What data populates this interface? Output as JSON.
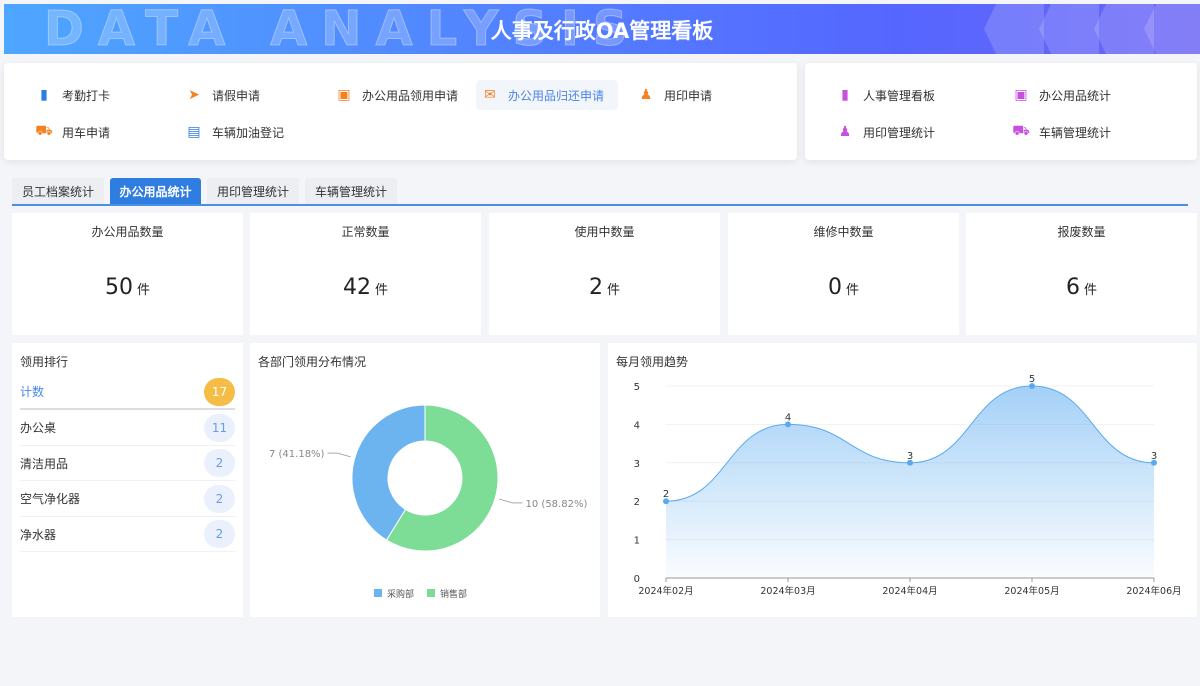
{
  "header": {
    "title": "人事及行政OA管理看板",
    "watermark": "DATA ANALYSIS"
  },
  "quick_left": [
    {
      "label": "考勤打卡",
      "icon": "bookmark-icon",
      "color": "#2f7de1"
    },
    {
      "label": "请假申请",
      "icon": "send-icon",
      "color": "#f58220"
    },
    {
      "label": "办公用品领用申请",
      "icon": "box-icon",
      "color": "#f58220"
    },
    {
      "label": "办公用品归还申请",
      "icon": "inbox-icon",
      "color": "#f58220"
    },
    {
      "label": "用印申请",
      "icon": "stamp-icon",
      "color": "#f58220"
    },
    {
      "label": "用车申请",
      "icon": "truck-icon",
      "color": "#f58220"
    },
    {
      "label": "车辆加油登记",
      "icon": "clipboard-icon",
      "color": "#2f7de1"
    }
  ],
  "quick_right": [
    {
      "label": "人事管理看板",
      "icon": "bar-chart-icon",
      "color": "#c84fe0"
    },
    {
      "label": "办公用品统计",
      "icon": "box-icon",
      "color": "#c84fe0"
    },
    {
      "label": "用印管理统计",
      "icon": "stamp-icon",
      "color": "#c84fe0"
    },
    {
      "label": "车辆管理统计",
      "icon": "truck-icon",
      "color": "#c84fe0"
    }
  ],
  "tabs": [
    "员工档案统计",
    "办公用品统计",
    "用印管理统计",
    "车辆管理统计"
  ],
  "active_tab": 1,
  "stats": [
    {
      "label": "办公用品数量",
      "value": "50",
      "unit": "件"
    },
    {
      "label": "正常数量",
      "value": "42",
      "unit": "件"
    },
    {
      "label": "使用中数量",
      "value": "2",
      "unit": "件"
    },
    {
      "label": "维修中数量",
      "value": "0",
      "unit": "件"
    },
    {
      "label": "报废数量",
      "value": "6",
      "unit": "件"
    }
  ],
  "ranking": {
    "title": "领用排行",
    "rows": [
      {
        "name": "计数",
        "count": "17"
      },
      {
        "name": "办公桌",
        "count": "11"
      },
      {
        "name": "清洁用品",
        "count": "2"
      },
      {
        "name": "空气净化器",
        "count": "2"
      },
      {
        "name": "净水器",
        "count": "2"
      }
    ]
  },
  "chart_data": [
    {
      "type": "pie",
      "title": "各部门领用分布情况",
      "legend_position": "bottom",
      "slices": [
        {
          "name": "采购部",
          "value": 7,
          "label": "7 (41.18%)",
          "color": "#6bb4f0"
        },
        {
          "name": "销售部",
          "value": 10,
          "label": "10 (58.82%)",
          "color": "#7ddc96"
        }
      ]
    },
    {
      "type": "area",
      "title": "每月领用趋势",
      "x": [
        "2024年02月",
        "2024年03月",
        "2024年04月",
        "2024年05月",
        "2024年06月"
      ],
      "values": [
        2,
        4,
        3,
        5,
        3
      ],
      "ylim": [
        0,
        5
      ],
      "yticks": [
        "0",
        "1",
        "2",
        "3",
        "4",
        "5"
      ],
      "color": "#5aaaf0"
    }
  ]
}
